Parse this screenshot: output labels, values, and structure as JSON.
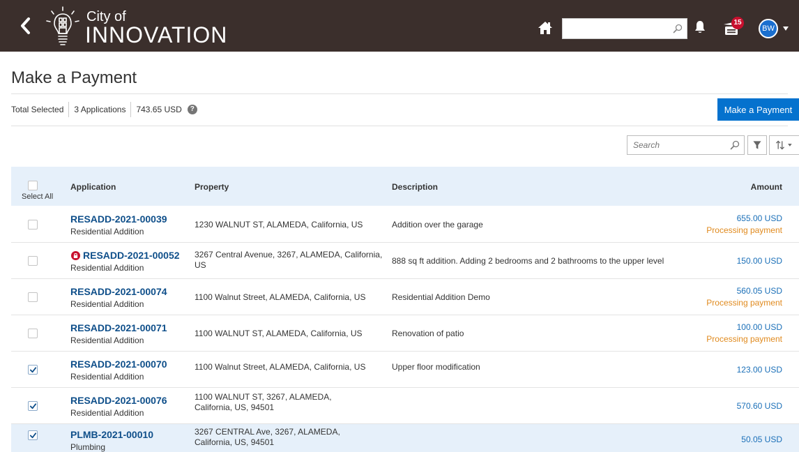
{
  "header": {
    "logo_small": "City of",
    "logo_big": "INNOVATION",
    "search_value": "",
    "cart_count": "15",
    "user_initials": "BW"
  },
  "page": {
    "title": "Make a Payment"
  },
  "summary": {
    "label": "Total Selected",
    "applications": "3 Applications",
    "total": "743.65 USD",
    "help": "?"
  },
  "pay_button": "Make a Payment",
  "toolbar": {
    "search_placeholder": "Search"
  },
  "table": {
    "headers": {
      "select_all": "Select All",
      "application": "Application",
      "property": "Property",
      "description": "Description",
      "amount": "Amount"
    },
    "rows": [
      {
        "id": "RESADD-2021-00039",
        "type": "Residential Addition",
        "property": "1230 WALNUT ST, ALAMEDA, California, US",
        "description": "Addition over the garage",
        "amount": "655.00 USD",
        "status": "Processing payment",
        "checked": false,
        "locked": false,
        "highlight": false
      },
      {
        "id": "RESADD-2021-00052",
        "type": "Residential Addition",
        "property": "3267 Central Avenue, 3267, ALAMEDA, California, US",
        "description": "888 sq ft addition.  Adding 2 bedrooms and 2 bathrooms to the upper level",
        "amount": "150.00 USD",
        "status": "",
        "checked": false,
        "locked": true,
        "highlight": false
      },
      {
        "id": "RESADD-2021-00074",
        "type": "Residential Addition",
        "property": "1100 Walnut Street, ALAMEDA, California, US",
        "description": "Residential Addition Demo",
        "amount": "560.05 USD",
        "status": "Processing payment",
        "checked": false,
        "locked": false,
        "highlight": false
      },
      {
        "id": "RESADD-2021-00071",
        "type": "Residential Addition",
        "property": "1100 WALNUT ST, ALAMEDA, California, US",
        "description": "Renovation of patio",
        "amount": "100.00 USD",
        "status": "Processing payment",
        "checked": false,
        "locked": false,
        "highlight": false
      },
      {
        "id": "RESADD-2021-00070",
        "type": "Residential Addition",
        "property": "1100 Walnut Street, ALAMEDA, California, US",
        "description": "Upper floor modification",
        "amount": "123.00 USD",
        "status": "",
        "checked": true,
        "locked": false,
        "highlight": false
      },
      {
        "id": "RESADD-2021-00076",
        "type": "Residential Addition",
        "property": "1100 WALNUT ST, 3267, ALAMEDA, California, US, 94501",
        "description": "",
        "amount": "570.60 USD",
        "status": "",
        "checked": true,
        "locked": false,
        "highlight": false
      },
      {
        "id": "PLMB-2021-00010",
        "type": "Plumbing",
        "property": "3267 CENTRAL Ave, 3267, ALAMEDA, California, US, 94501",
        "description": "",
        "amount": "50.05 USD",
        "status": "",
        "checked": true,
        "locked": false,
        "highlight": true
      }
    ]
  },
  "icons": {
    "back": "chevron-left-icon",
    "logo": "lightbulb-logo-icon",
    "home": "home-icon",
    "search": "search-icon",
    "bell": "bell-icon",
    "cart": "cart-icon",
    "lock": "lock-icon",
    "filter": "filter-icon",
    "sort": "sort-icon"
  },
  "colors": {
    "header_bg": "#3b2f2c",
    "primary_button": "#0572ce",
    "link": "#0f4f8a",
    "amount": "#1a6fb8",
    "status": "#e08a1e",
    "table_header_bg": "#e6f0fa",
    "badge": "#c8102e",
    "lock": "#c8102e"
  }
}
